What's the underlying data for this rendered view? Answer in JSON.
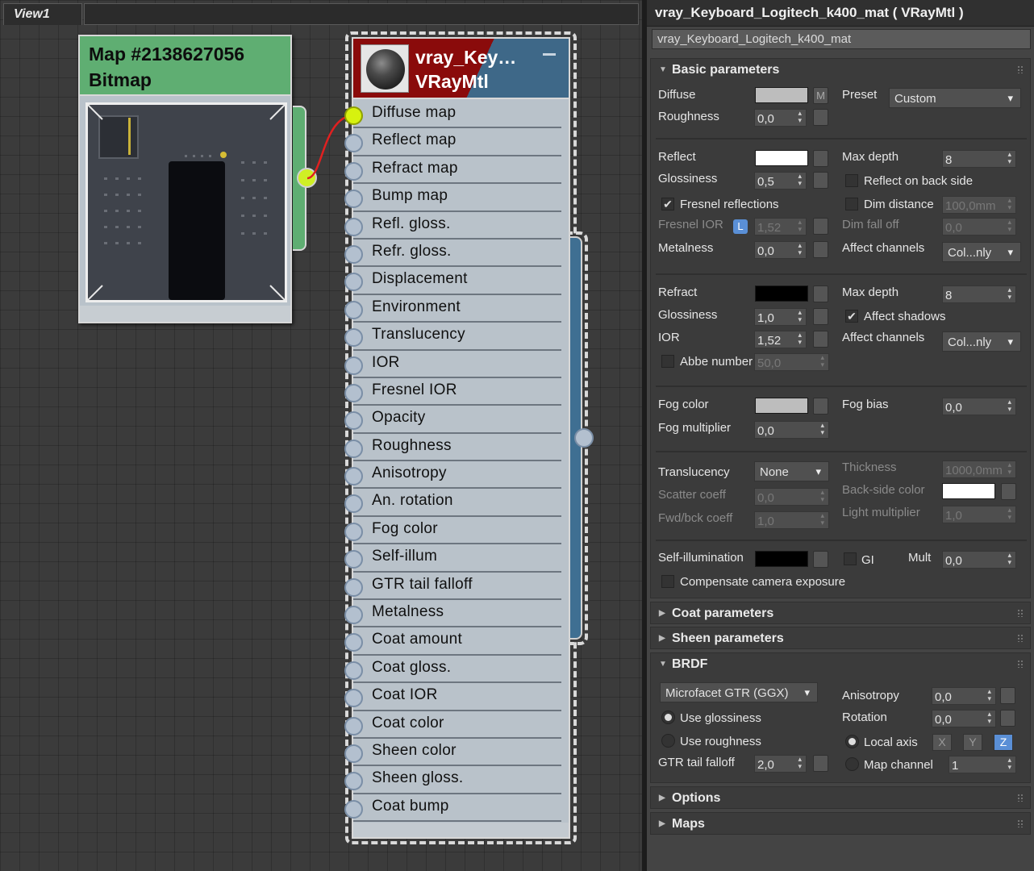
{
  "view": {
    "tab_label": "View1"
  },
  "bitmap_node": {
    "title_line1": "Map #2138627056",
    "title_line2": "Bitmap"
  },
  "material_node": {
    "title_line1": "vray_Key…",
    "title_line2": "VRayMtl",
    "slots": [
      "Diffuse map",
      "Reflect map",
      "Refract map",
      "Bump map",
      "Refl. gloss.",
      "Refr. gloss.",
      "Displacement",
      "Environment",
      "Translucency",
      "IOR",
      "Fresnel IOR",
      "Opacity",
      "Roughness",
      "Anisotropy",
      "An. rotation",
      "Fog color",
      "Self-illum",
      "GTR tail falloff",
      "Metalness",
      "Coat amount",
      "Coat gloss.",
      "Coat IOR",
      "Coat color",
      "Sheen color",
      "Sheen gloss.",
      "Coat bump"
    ],
    "connected_slot": "Diffuse map"
  },
  "panel": {
    "title": "vray_Keyboard_Logitech_k400_mat  ( VRayMtl )",
    "material_name": "vray_Keyboard_Logitech_k400_mat",
    "basic": {
      "header": "Basic parameters",
      "diffuse": "Diffuse",
      "diffuse_m": "M",
      "preset": "Preset",
      "preset_value": "Custom",
      "roughness": "Roughness",
      "roughness_value": "0,0",
      "reflect": "Reflect",
      "max_depth": "Max depth",
      "reflect_max_depth": "8",
      "glossiness": "Glossiness",
      "refl_gloss_value": "0,5",
      "reflect_back": "Reflect on back side",
      "fresnel": "Fresnel reflections",
      "dim_distance": "Dim distance",
      "dim_distance_value": "100,0mm",
      "fresnel_ior": "Fresnel IOR",
      "l_badge": "L",
      "fresnel_ior_value": "1,52",
      "dim_falloff": "Dim fall off",
      "dim_falloff_value": "0,0",
      "metalness": "Metalness",
      "metalness_value": "0,0",
      "affect_channels": "Affect channels",
      "affect_channels_value": "Col...nly",
      "refract": "Refract",
      "refract_max_depth": "8",
      "refr_gloss_value": "1,0",
      "affect_shadows": "Affect shadows",
      "ior": "IOR",
      "ior_value": "1,52",
      "affect_channels_value2": "Col...nly",
      "abbe": "Abbe number",
      "abbe_value": "50,0",
      "fog_color": "Fog color",
      "fog_bias": "Fog bias",
      "fog_bias_value": "0,0",
      "fog_mult": "Fog multiplier",
      "fog_mult_value": "0,0",
      "translucency": "Translucency",
      "translucency_value": "None",
      "thickness": "Thickness",
      "thickness_value": "1000,0mm",
      "scatter": "Scatter coeff",
      "scatter_value": "0,0",
      "backside_color": "Back-side color",
      "fwdbck": "Fwd/bck coeff",
      "fwdbck_value": "1,0",
      "light_mult": "Light multiplier",
      "light_mult_value": "1,0",
      "self_illum": "Self-illumination",
      "gi": "GI",
      "mult": "Mult",
      "mult_value": "0,0",
      "compensate": "Compensate camera exposure"
    },
    "coat_header": "Coat parameters",
    "sheen_header": "Sheen parameters",
    "brdf": {
      "header": "BRDF",
      "type": "Microfacet GTR (GGX)",
      "anisotropy": "Anisotropy",
      "anisotropy_value": "0,0",
      "use_gloss": "Use glossiness",
      "rotation": "Rotation",
      "rotation_value": "0,0",
      "use_rough": "Use roughness",
      "local_axis": "Local axis",
      "x": "X",
      "y": "Y",
      "z": "Z",
      "gtr": "GTR tail falloff",
      "gtr_value": "2,0",
      "map_channel": "Map channel",
      "map_channel_value": "1"
    },
    "options_header": "Options",
    "maps_header": "Maps"
  },
  "colors": {
    "bitmap_header": "#5fae72",
    "mtl_header_red": "#8a0b0b",
    "mtl_header_blue": "#3e6888",
    "wire": "#e02020",
    "active_socket": "#d7f20f",
    "diffuse_swatch": "#bdbdbd",
    "reflect_swatch": "#ffffff",
    "refract_swatch": "#000000",
    "fog_swatch": "#bdbdbd",
    "backside_swatch": "#ffffff",
    "selfillum_swatch": "#000000"
  }
}
